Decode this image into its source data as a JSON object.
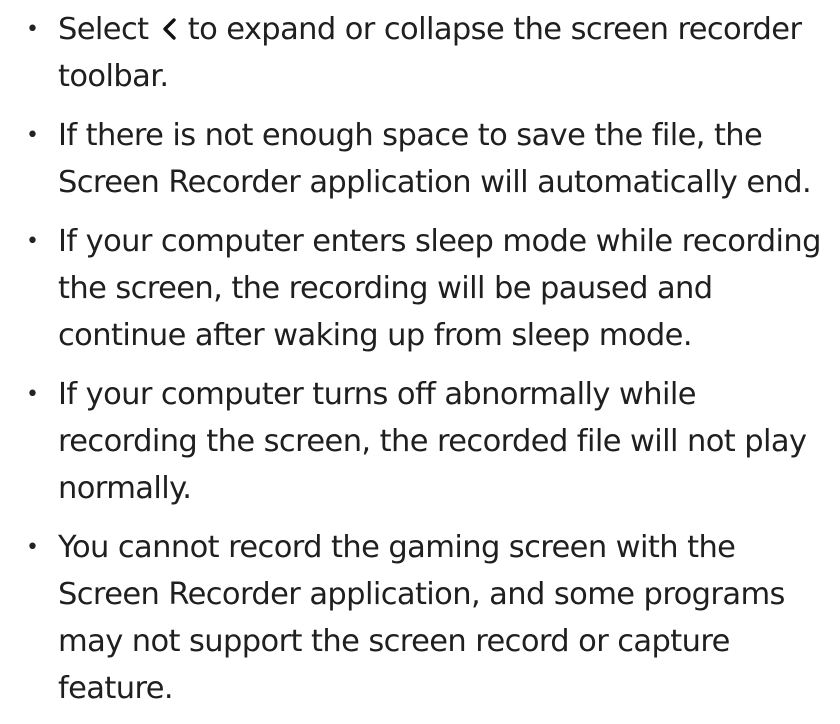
{
  "bullet_glyph": "•",
  "notes": [
    {
      "before_icon": "Select",
      "icon": "chevron-left-icon",
      "after_icon": "to expand or collapse the screen recorder toolbar."
    },
    {
      "text": "If there is not enough space to save the file, the Screen Recorder application will automatically end."
    },
    {
      "text": "If your computer enters sleep mode while recording the screen, the recording will be paused and continue after waking up from sleep mode."
    },
    {
      "text": "If your computer turns off abnormally while recording the screen, the recorded file will not play normally."
    },
    {
      "text": "You cannot record the gaming screen with the Screen Recorder application, and some programs may not support the screen record or capture feature."
    }
  ]
}
